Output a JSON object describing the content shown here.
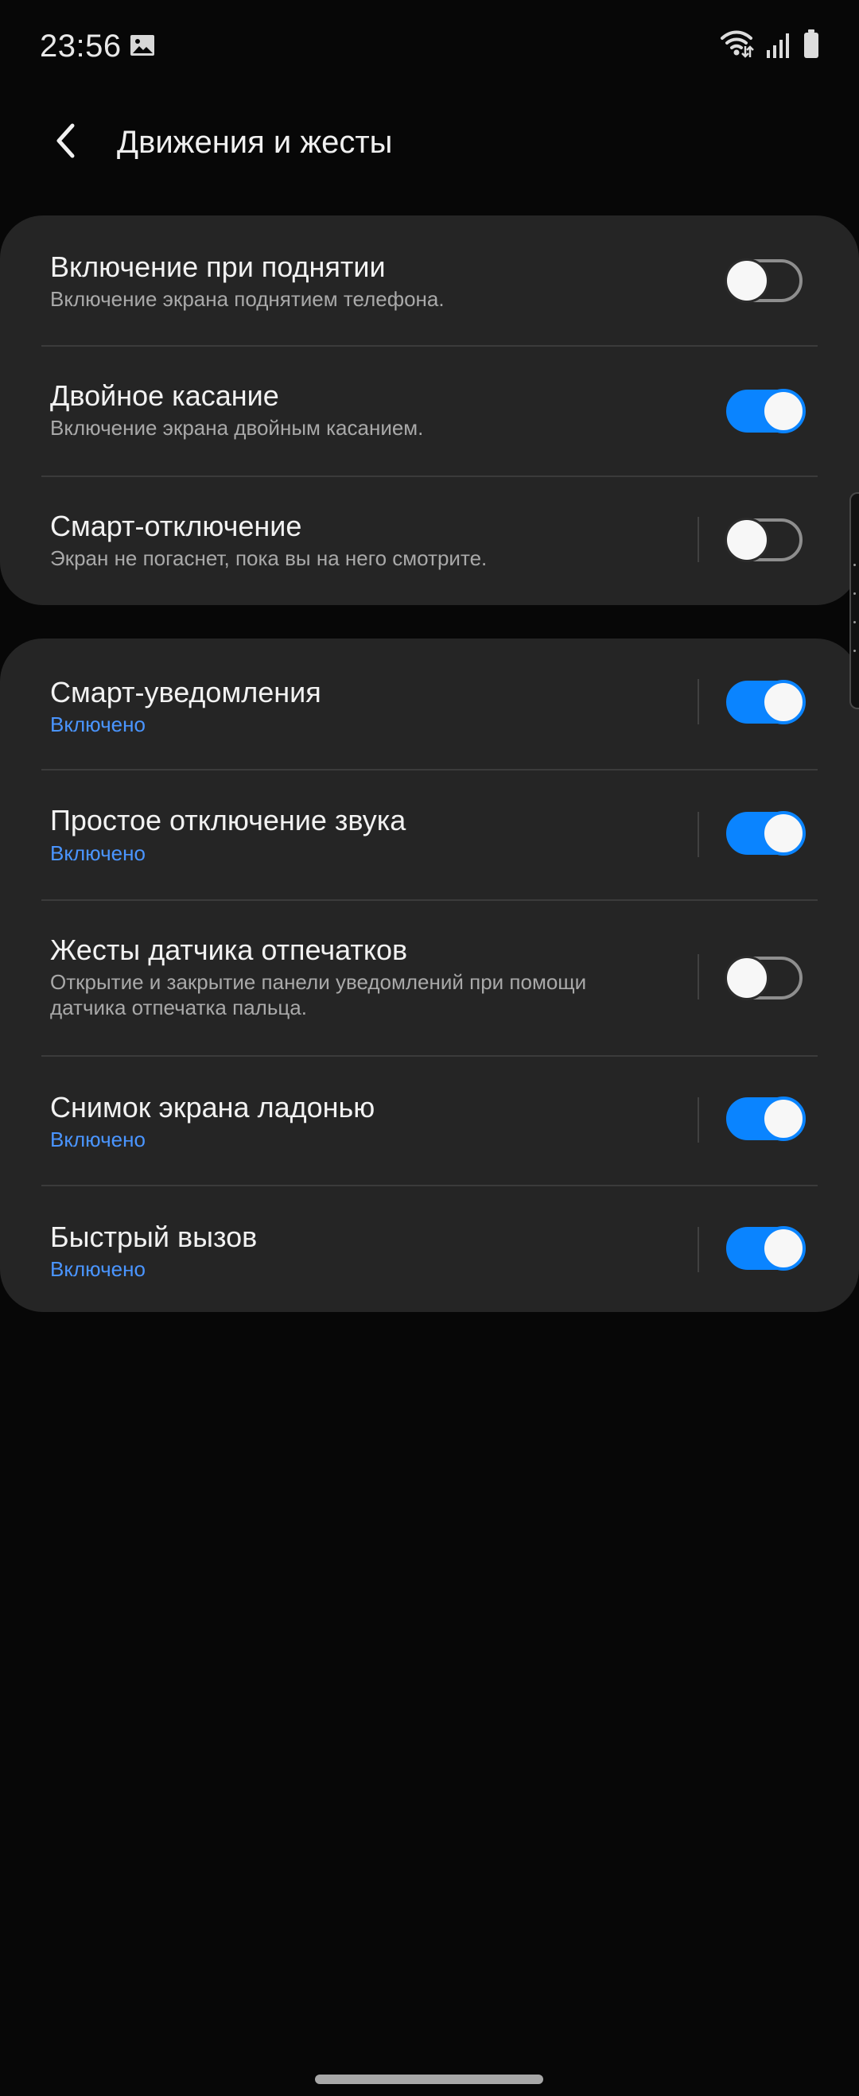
{
  "status_bar": {
    "time": "23:56",
    "left_icon": "gallery-icon",
    "right_icons": [
      "wifi-icon",
      "signal-icon",
      "battery-icon"
    ]
  },
  "header": {
    "back_icon": "back-icon",
    "title": "Движения и жесты"
  },
  "colors": {
    "background": "#070707",
    "card": "#252525",
    "accent": "#0a84ff",
    "status_text": "#4a95ff",
    "primary_text": "#f2f2f2",
    "secondary_text": "#a9a9a9"
  },
  "section_1": {
    "items": [
      {
        "title": "Включение при поднятии",
        "subtitle": "Включение экрана поднятием телефона.",
        "enabled": false
      },
      {
        "title": "Двойное касание",
        "subtitle": "Включение экрана двойным касанием.",
        "enabled": true
      },
      {
        "title": "Смарт-отключение",
        "subtitle": "Экран не погаснет, пока вы на него смотрите.",
        "enabled": false
      }
    ]
  },
  "section_2": {
    "items": [
      {
        "title": "Смарт-уведомления",
        "status": "Включено",
        "enabled": true
      },
      {
        "title": "Простое отключение звука",
        "status": "Включено",
        "enabled": true
      },
      {
        "title": "Жесты датчика отпечатков",
        "subtitle": "Открытие и закрытие панели уведомлений при помощи датчика отпечатка пальца.",
        "enabled": false
      },
      {
        "title": "Снимок экрана ладонью",
        "status": "Включено",
        "enabled": true
      },
      {
        "title": "Быстрый вызов",
        "status": "Включено",
        "enabled": true
      }
    ]
  }
}
